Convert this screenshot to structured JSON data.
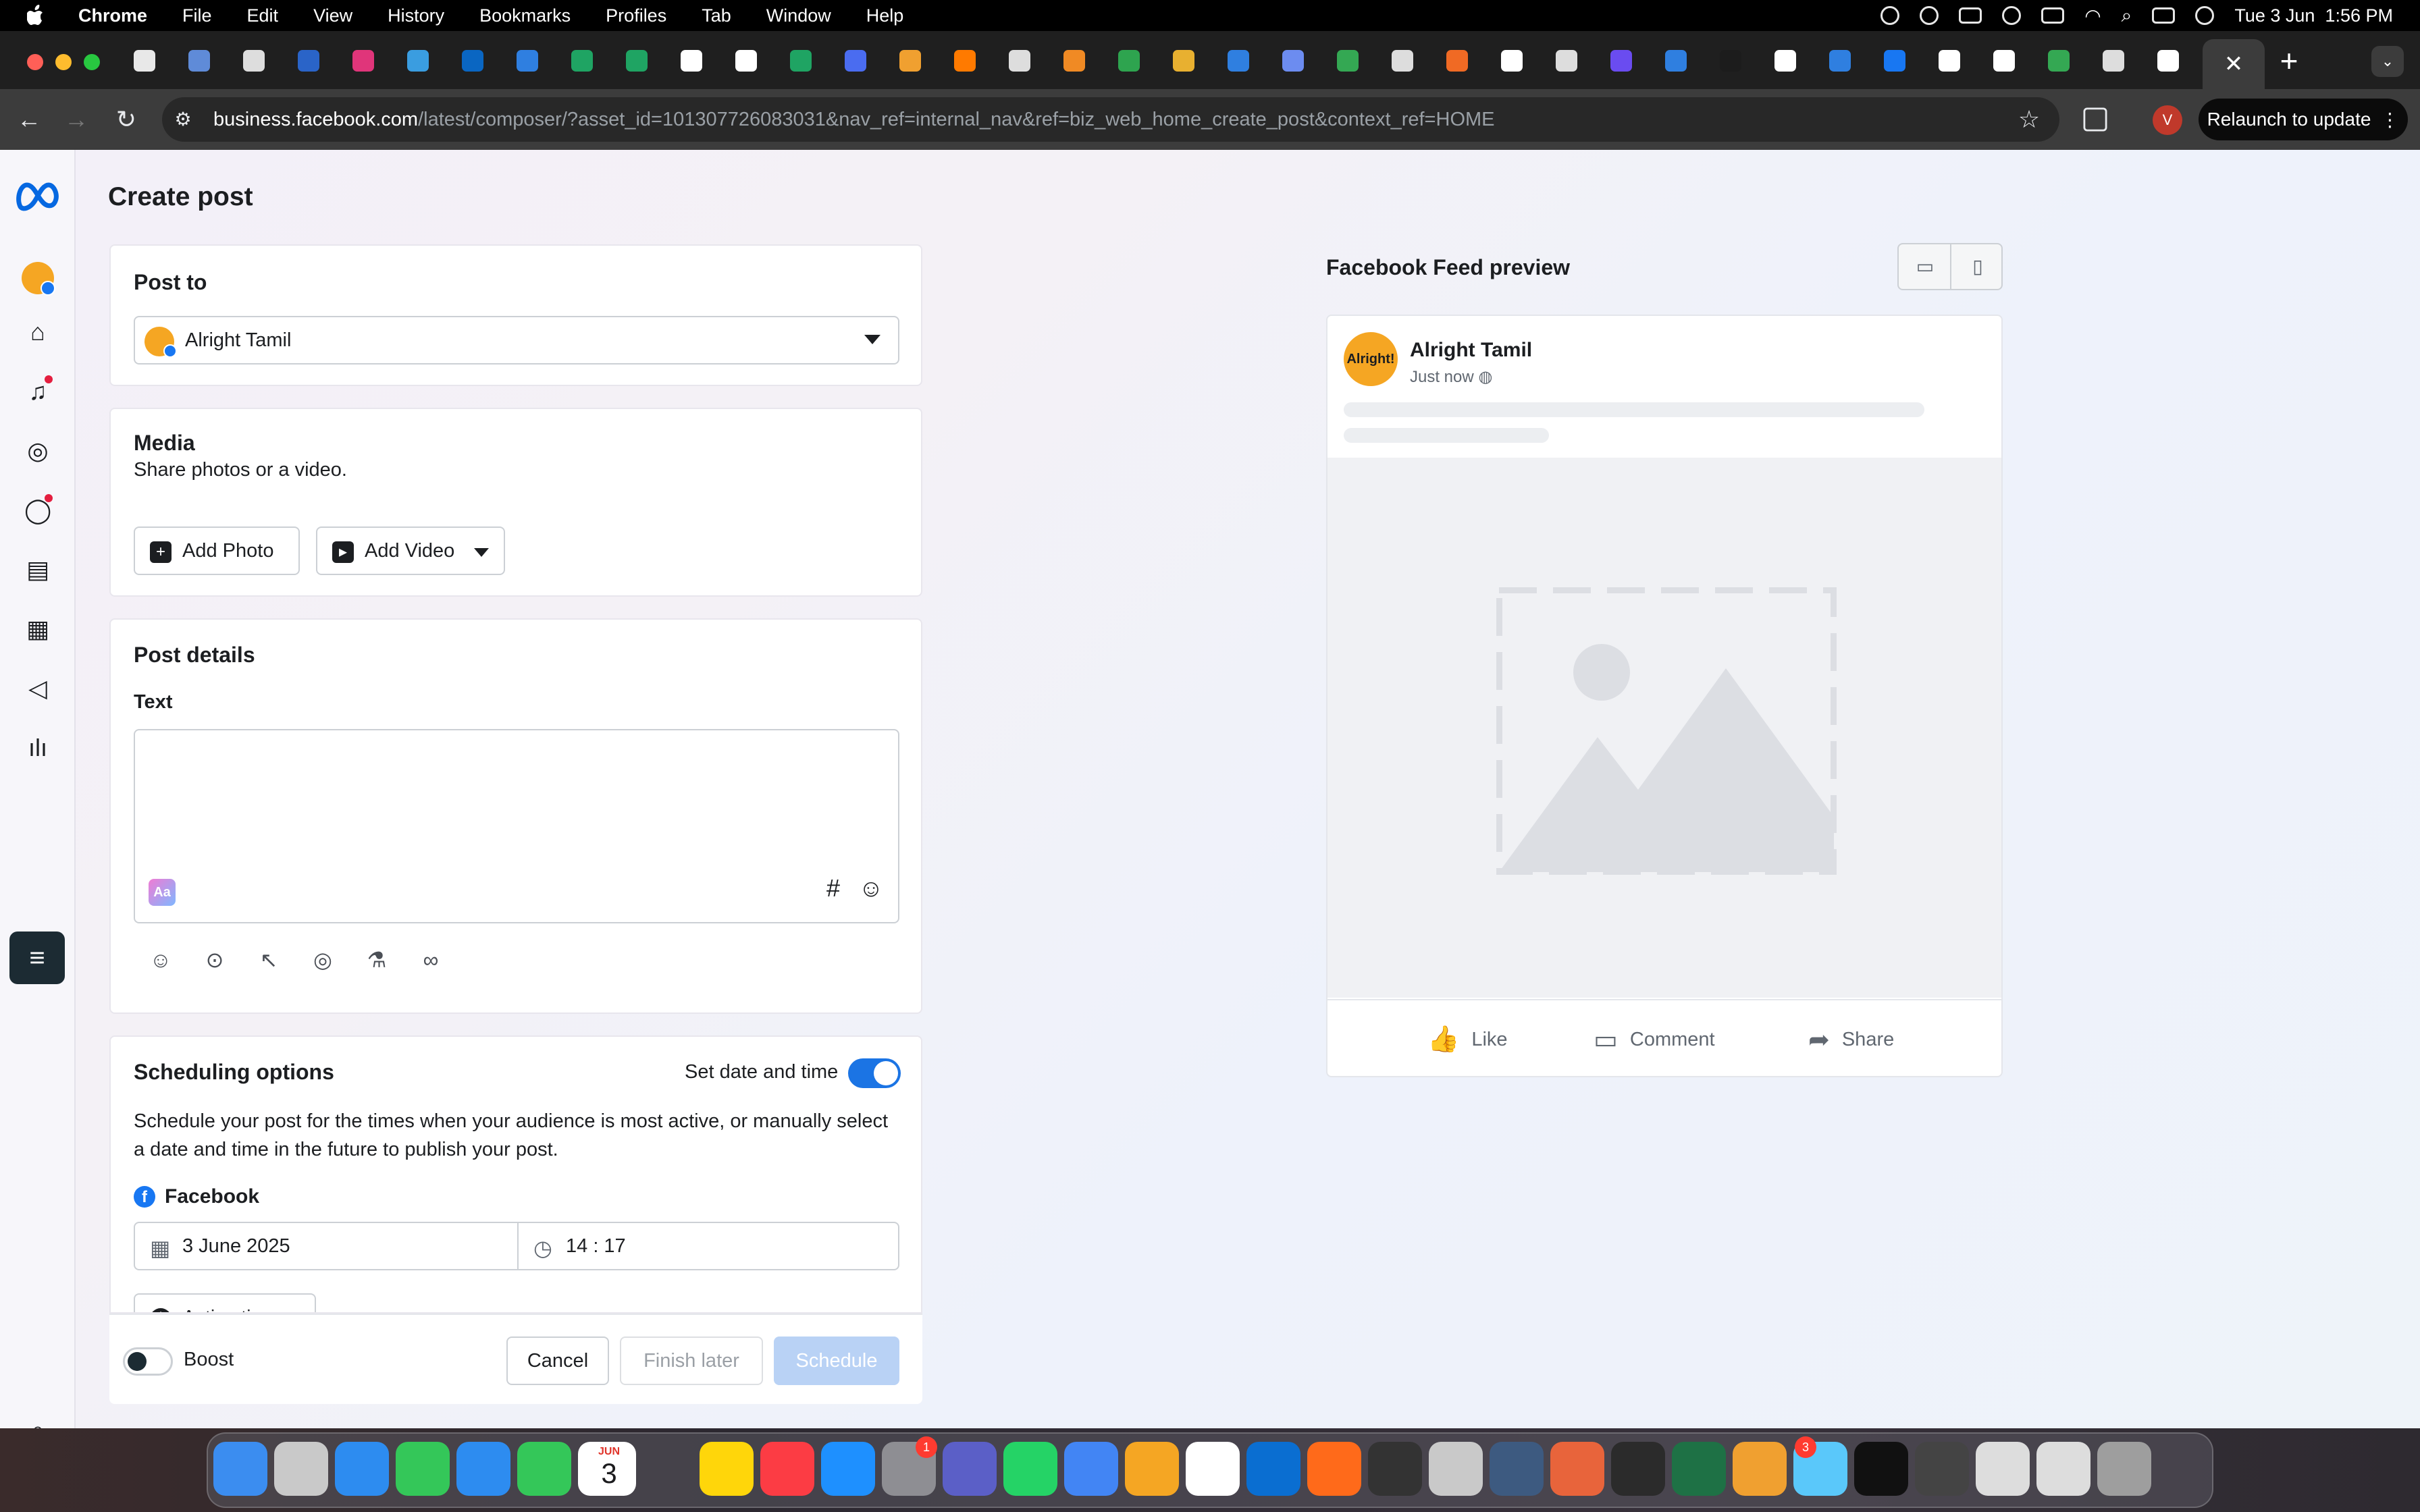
{
  "menubar": {
    "app_name": "Chrome",
    "items": [
      "File",
      "Edit",
      "View",
      "History",
      "Bookmarks",
      "Profiles",
      "Tab",
      "Window",
      "Help"
    ],
    "clock": "Tue 3 Jun  1:56 PM"
  },
  "browser": {
    "url_host": "business.facebook.com",
    "url_path": "/latest/composer/?asset_id=101307726083031&nav_ref=internal_nav&ref=biz_web_home_create_post&context_ref=HOME",
    "relaunch_label": "Relaunch to update",
    "profile_initial": "V"
  },
  "page": {
    "title": "Create post"
  },
  "post_to": {
    "heading": "Post to",
    "selected_page": "Alright Tamil"
  },
  "media": {
    "heading": "Media",
    "subtitle": "Share photos or a video.",
    "add_photo": "Add Photo",
    "add_video": "Add Video"
  },
  "post_details": {
    "heading": "Post details",
    "text_label": "Text",
    "text_value": "",
    "aa_label": "Aa",
    "hashtag": "#"
  },
  "scheduling": {
    "heading": "Scheduling options",
    "toggle_label": "Set date and time",
    "toggle_on": true,
    "description": "Schedule your post for the times when your audience is most active, or manually select a date and time in the future to publish your post.",
    "platform": "Facebook",
    "date": "3 June 2025",
    "time": "14 : 17",
    "partial_button": "Active times"
  },
  "footer": {
    "boost_label": "Boost",
    "cancel": "Cancel",
    "finish_later": "Finish later",
    "schedule": "Schedule"
  },
  "preview": {
    "heading": "Facebook Feed preview",
    "page_name": "Alright Tamil",
    "avatar_text": "Alright!",
    "timestamp": "Just now",
    "like": "Like",
    "comment": "Comment",
    "share": "Share"
  },
  "colors": {
    "accent": "#1b74e4",
    "facebook_blue": "#1877f2",
    "schedule_disabled": "#b9d2f5",
    "avatar_orange": "#f5a623"
  },
  "dock": {
    "calendar_month": "JUN",
    "calendar_day": "3",
    "badge_settings": "1",
    "badge_app": "3"
  }
}
